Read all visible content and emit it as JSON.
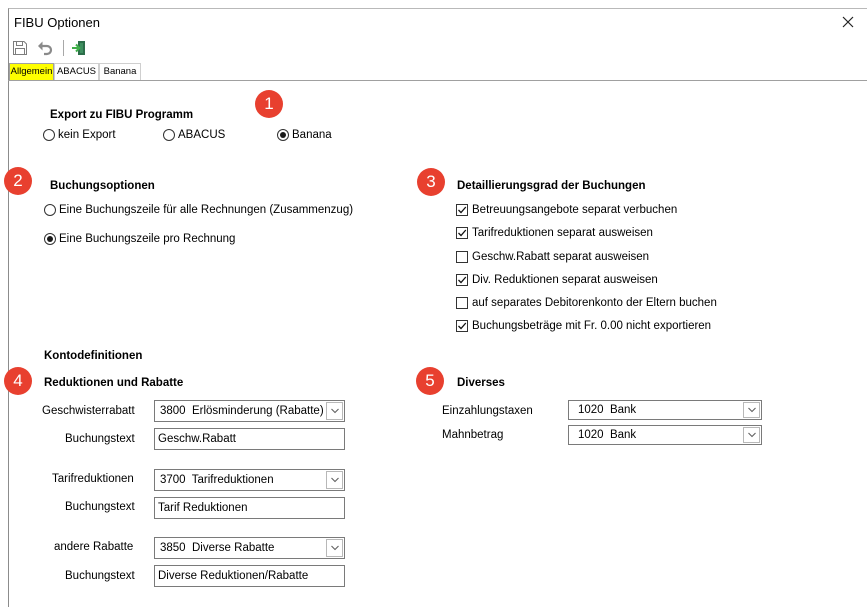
{
  "window": {
    "title": "FIBU Optionen",
    "close_icon": "close-icon"
  },
  "toolbar": {
    "icons": [
      "save-icon",
      "undo-icon",
      "exit-icon"
    ]
  },
  "tabs": [
    {
      "label": "Allgemein",
      "active": true
    },
    {
      "label": "ABACUS",
      "active": false
    },
    {
      "label": "Banana",
      "active": false
    }
  ],
  "markers": [
    "1",
    "2",
    "3",
    "4",
    "5"
  ],
  "export": {
    "title": "Export zu FIBU Programm",
    "options": [
      {
        "label": "kein Export",
        "checked": false
      },
      {
        "label": "ABACUS",
        "checked": false
      },
      {
        "label": "Banana",
        "checked": true
      }
    ]
  },
  "booking_options": {
    "title": "Buchungsoptionen",
    "options": [
      {
        "label": "Eine Buchungszeile für alle Rechnungen (Zusammenzug)",
        "checked": false
      },
      {
        "label": "Eine Buchungszeile pro Rechnung",
        "checked": true
      }
    ]
  },
  "detail": {
    "title": "Detaillierungsgrad der Buchungen",
    "options": [
      {
        "label": "Betreuungsangebote separat verbuchen",
        "checked": true
      },
      {
        "label": "Tarifreduktionen separat ausweisen",
        "checked": true
      },
      {
        "label": "Geschw.Rabatt separat ausweisen",
        "checked": false
      },
      {
        "label": "Div. Reduktionen separat ausweisen",
        "checked": true
      },
      {
        "label": "auf separates Debitorenkonto der Eltern buchen",
        "checked": false
      },
      {
        "label": "Buchungsbeträge mit Fr. 0.00 nicht exportieren",
        "checked": true
      }
    ]
  },
  "accounts": {
    "title": "Kontodefinitionen",
    "reductions": {
      "title": "Reduktionen und Rabatte",
      "rows": [
        {
          "label": "Geschwisterrabatt",
          "account": "3800  Erlösminderung (Rabatte)",
          "text_label": "Buchungstext",
          "text_value": "Geschw.Rabatt"
        },
        {
          "label": "Tarifreduktionen",
          "account": "3700  Tarifreduktionen",
          "text_label": "Buchungstext",
          "text_value": "Tarif Reduktionen"
        },
        {
          "label": "andere Rabatte",
          "account": "3850  Diverse Rabatte",
          "text_label": "Buchungstext",
          "text_value": "Diverse Reduktionen/Rabatte"
        }
      ]
    },
    "misc": {
      "title": "Diverses",
      "rows": [
        {
          "label": "Einzahlungstaxen",
          "account": "1020  Bank"
        },
        {
          "label": "Mahnbetrag",
          "account": "1020  Bank"
        }
      ]
    }
  },
  "colors": {
    "marker": "#e8402f",
    "active_tab": "#ffff00",
    "window_border": "#8c8c8c"
  }
}
